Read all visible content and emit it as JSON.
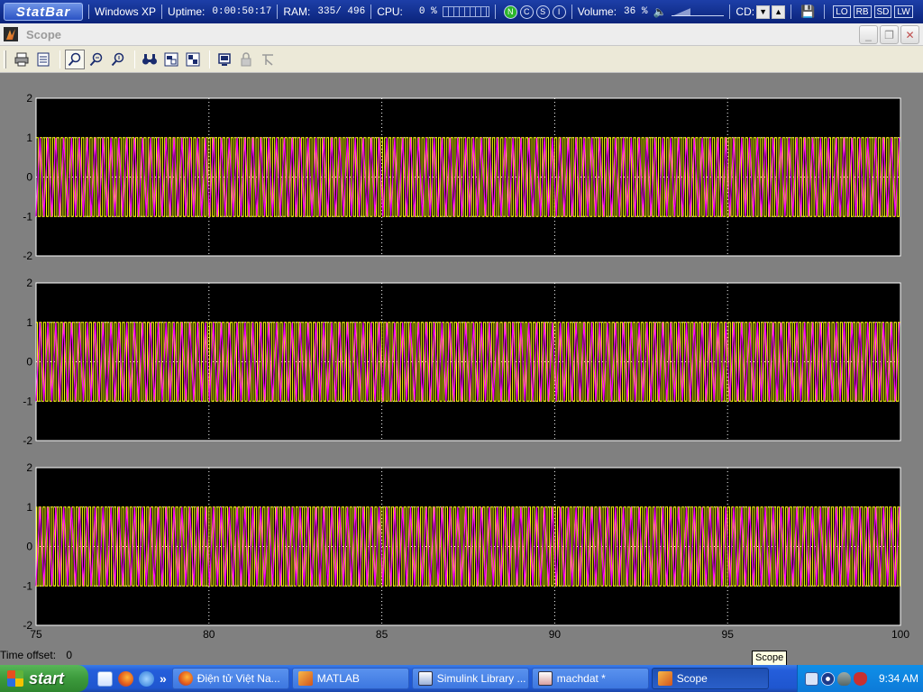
{
  "statbar": {
    "logo": "StatBar",
    "os": "Windows XP",
    "uptime_label": "Uptime:",
    "uptime_value": "0:00:50:17",
    "ram_label": "RAM:",
    "ram_value": "335/ 496",
    "cpu_label": "CPU:",
    "cpu_value": "0 %",
    "buttons": [
      "N",
      "C",
      "S",
      "I"
    ],
    "volume_label": "Volume:",
    "volume_value": "36 %",
    "volume_level": 0.36,
    "cd_label": "CD:",
    "badges": [
      "LO",
      "RB",
      "SD",
      "LW"
    ]
  },
  "window": {
    "title": "Scope",
    "minimize": "_",
    "maximize": "❐",
    "close": "✕"
  },
  "toolbar": {
    "icons": [
      "print-icon",
      "parameters-icon",
      "zoom-icon",
      "zoom-x-icon",
      "zoom-y-icon",
      "autoscale-icon",
      "save-axes-icon",
      "restore-axes-icon",
      "floating-scope-icon",
      "lock-axes-icon",
      "signal-selection-icon"
    ]
  },
  "scope": {
    "x_ticks": [
      "75",
      "80",
      "85",
      "90",
      "95",
      "100"
    ],
    "y_ticks": [
      "2",
      "1",
      "0",
      "-1",
      "-2"
    ],
    "colors": {
      "background": "#000000",
      "signal_1": "#ffff00",
      "signal_2": "#ff00ff",
      "grid": "#ffffff",
      "frame": "#808080"
    }
  },
  "chart_data": [
    {
      "type": "line",
      "xlim": [
        75,
        100
      ],
      "ylim": [
        -2,
        2
      ],
      "grid": true,
      "series": [
        {
          "color": "#ffff00",
          "amplitude": 1,
          "shape": "square wave"
        },
        {
          "color": "#ff00ff",
          "amplitude": 1,
          "shape": "triangle wave"
        }
      ]
    },
    {
      "type": "line",
      "xlim": [
        75,
        100
      ],
      "ylim": [
        -2,
        2
      ],
      "grid": true,
      "series": [
        {
          "color": "#ffff00",
          "amplitude": 1,
          "shape": "square wave"
        },
        {
          "color": "#ff00ff",
          "amplitude": 1,
          "shape": "triangle wave"
        }
      ]
    },
    {
      "type": "line",
      "xlim": [
        75,
        100
      ],
      "ylim": [
        -2,
        2
      ],
      "grid": true,
      "series": [
        {
          "color": "#ffff00",
          "amplitude": 1,
          "shape": "square wave"
        },
        {
          "color": "#ff00ff",
          "amplitude": 1,
          "shape": "triangle wave"
        }
      ]
    }
  ],
  "footer": {
    "time_offset_label": "Time offset:",
    "time_offset_value": "0",
    "tooltip": "Scope"
  },
  "taskbar": {
    "start": "start",
    "tasks": [
      {
        "label": "Điện tử Việt Na...",
        "icon": "firefox-icon",
        "active": false
      },
      {
        "label": "MATLAB",
        "icon": "matlab-icon",
        "active": false
      },
      {
        "label": "Simulink Library ...",
        "icon": "simulink-icon",
        "active": false
      },
      {
        "label": "machdat *",
        "icon": "simulink-model-icon",
        "active": false
      },
      {
        "label": "Scope",
        "icon": "matlab-icon",
        "active": true
      }
    ],
    "clock": "9:34 AM"
  }
}
